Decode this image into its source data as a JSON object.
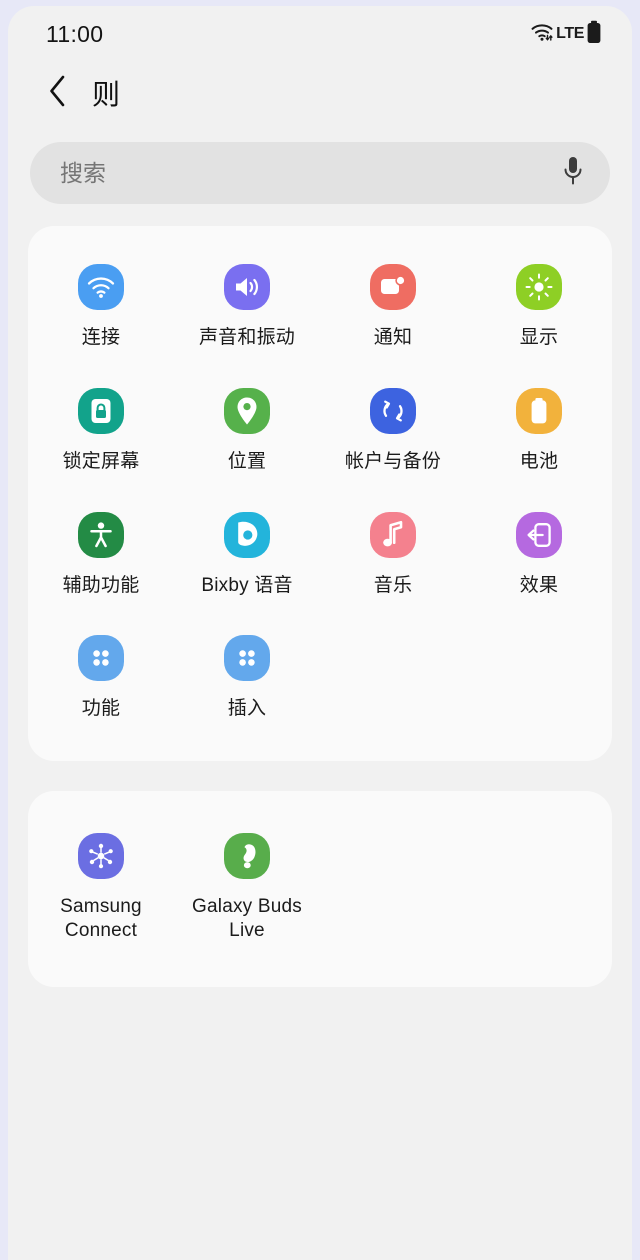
{
  "status_bar": {
    "time": "11:00",
    "network_label": "LTE",
    "wifi_icon": "wifi-icon",
    "battery_icon": "battery-full-icon"
  },
  "header": {
    "back_icon": "chevron-left-icon",
    "title": "则"
  },
  "search": {
    "placeholder": "搜索",
    "value": "",
    "mic_icon": "microphone-icon"
  },
  "settings_grid": [
    {
      "label": "连接",
      "icon": "wifi-icon",
      "color": "#4a9ef2"
    },
    {
      "label": "声音和振动",
      "icon": "speaker-icon",
      "color": "#7a6ff0"
    },
    {
      "label": "通知",
      "icon": "notification-icon",
      "color": "#ef6d62"
    },
    {
      "label": "显示",
      "icon": "brightness-icon",
      "color": "#8ecf25"
    },
    {
      "label": "锁定屏幕",
      "icon": "lock-icon",
      "color": "#12a38b"
    },
    {
      "label": "位置",
      "icon": "location-pin-icon",
      "color": "#56b14b"
    },
    {
      "label": "帐户与备份",
      "icon": "sync-icon",
      "color": "#3d63e0"
    },
    {
      "label": "电池",
      "icon": "battery-icon",
      "color": "#f2b23c"
    },
    {
      "label": "辅助功能",
      "icon": "accessibility-icon",
      "color": "#238b45"
    },
    {
      "label": "Bixby 语音",
      "icon": "bixby-icon",
      "color": "#23b4db"
    },
    {
      "label": "音乐",
      "icon": "music-note-icon",
      "color": "#f4818e"
    },
    {
      "label": "效果",
      "icon": "effects-icon",
      "color": "#b569e0"
    },
    {
      "label": "功能",
      "icon": "grid-dots-icon",
      "color": "#63a8ec"
    },
    {
      "label": "插入",
      "icon": "grid-dots-icon",
      "color": "#63a8ec"
    }
  ],
  "devices_grid": [
    {
      "label": "Samsung Connect",
      "icon": "connect-hub-icon",
      "color": "#6b6ee2"
    },
    {
      "label": "Galaxy Buds Live",
      "icon": "earbud-icon",
      "color": "#58ad4b"
    }
  ],
  "colors": {
    "page_background": "#f1f1f1",
    "card_background": "#fafafa",
    "search_background": "#e2e2e2",
    "outer_background": "#e7e8f7"
  }
}
